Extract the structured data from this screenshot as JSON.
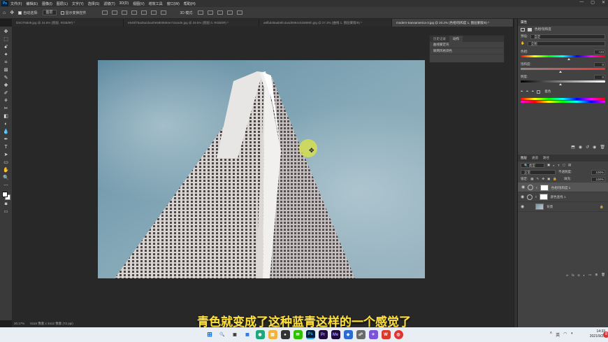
{
  "menubar": {
    "logo": "Ps",
    "items": [
      "文件(F)",
      "编辑(E)",
      "图像(I)",
      "图层(L)",
      "文字(Y)",
      "选择(S)",
      "滤镜(T)",
      "3D(D)",
      "视图(V)",
      "增效工具",
      "窗口(W)",
      "帮助(H)"
    ],
    "window_controls": [
      "—",
      "▢",
      "✕"
    ]
  },
  "options_bar": {
    "auto_select_label": "自动选择:",
    "auto_select_value": "图层",
    "show_transform_label": "显示变换控件",
    "mode_3d_label": "3D 模式:"
  },
  "tabs": [
    {
      "label": "DSCF5849.jpg @ 24.6% (图层, RGB/8#) *",
      "active": false
    },
    {
      "label": "e545f75a25a1ba40e5800694e7c5cede.jpg @ 29.5% (图层 0, RGB/8#) *",
      "active": false
    },
    {
      "label": "a8fbd48aab6fc4a4d0994c628895h.jpg @ 27.3% (曲线 1, 图层蒙版/8) *",
      "active": false
    },
    {
      "label": "modern-transamerica-3.jpg @ 20.2% (色相/饱和度 1, 图层蒙版/8) *",
      "active": true
    }
  ],
  "toolbar_icons": [
    "✥",
    "⬚",
    "ꗃ",
    "✦",
    "⌗",
    "⊠",
    "✎",
    "✚",
    "✐",
    "⚘",
    "✂",
    "◧",
    "◐",
    "💧",
    "✒",
    "T",
    "➤",
    "▭",
    "✋",
    "🔍",
    "⋯"
  ],
  "history_panel": {
    "tabs": [
      "历史记录",
      "动作"
    ],
    "rows": [
      "曲线蒙定块",
      "联网风格调色"
    ]
  },
  "properties": {
    "header": [
      "属性"
    ],
    "adjustment_title": "色相/饱和度",
    "preset_label": "预设:",
    "preset_value": "自定",
    "channel_value": "全图",
    "hue_label": "色相:",
    "hue_value": "+23",
    "saturation_label": "饱和度:",
    "saturation_value": "0",
    "lightness_label": "明度:",
    "lightness_value": "0",
    "colorize_label": "着色"
  },
  "layers_panel": {
    "tabs": [
      "图层",
      "通道",
      "路径"
    ],
    "filter_label": "类型",
    "blend_mode": "正常",
    "opacity_label": "不透明度:",
    "opacity_value": "100%",
    "lock_label": "锁定:",
    "fill_label": "填充:",
    "fill_value": "100%",
    "layers": [
      {
        "name": "色相/饱和度 1",
        "selected": true
      },
      {
        "name": "颜色查找 1",
        "selected": false
      },
      {
        "name": "背景",
        "selected": false
      }
    ]
  },
  "status": {
    "zoom": "20.17%",
    "doc_size": "5116 像素 x 3412 像素 (72 ppi)"
  },
  "subtitle": "青色就变成了这种蓝青这样的一个感觉了",
  "taskbar": {
    "time": "14:33",
    "date": "2021/9/25",
    "apps": [
      "⊞",
      "🔍",
      "▣",
      "▦",
      "◉",
      "▤",
      "♠",
      "✉",
      "Ps",
      "Pr",
      "Me",
      "◈",
      "☍",
      "✧",
      "W",
      "◎"
    ],
    "lang": "英",
    "notif": "8"
  },
  "colors": {
    "ps_blue": "#31a8ff",
    "subtitle_yellow": "#ffe03a",
    "sky": "#6d97ab"
  }
}
